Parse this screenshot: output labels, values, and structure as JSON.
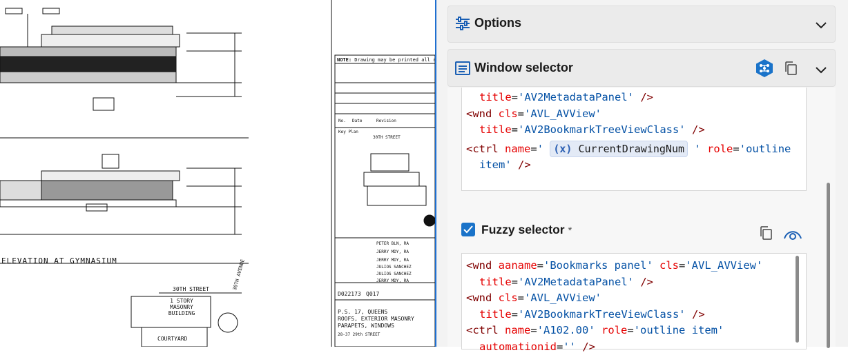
{
  "drawing": {
    "notice_label": "NOTE:",
    "notice_text": "Drawing may be printed all reduced",
    "date_label": "No.",
    "date_col": "Date",
    "revision_col": "Revision",
    "key_plan": "Key Plan",
    "street_top": "30TH STREET",
    "street_bottom": "30TH STREET",
    "avenue": "30TH AVENUE",
    "elevation_title": "ELEVATION AT GYMNASIUM",
    "story_building": "1 STORY MASONRY BUILDING",
    "courtyard": "COURTYARD",
    "project_number": "D022173",
    "project_label": "Q017",
    "project_title": "P.S. 17, QUEENS",
    "project_subtitle": "ROOFS, EXTERIOR MASONRY",
    "project_subtitle2": "PARAPETS, WINDOWS",
    "address": "28-37 29th STREET",
    "names": [
      "PETER BLN, RA",
      "JERRY MDY, RA",
      "JERRY MDY, RA",
      "JULIOS SANCHEZ",
      "JULIOS SANCHEZ",
      "JERRY MDY, RA"
    ]
  },
  "options": {
    "title": "Options",
    "icon": "sliders-icon",
    "chevron": "chevron-down-icon"
  },
  "window_selector": {
    "title": "Window selector",
    "icon": "window-icon",
    "action_icon": "tree-picker-icon",
    "copy_icon": "copy-icon",
    "chevron": "chevron-down-icon",
    "colors": {
      "action": "#1a73c9"
    },
    "code": {
      "line1": {
        "attr": "title",
        "eq": "=",
        "val": "'AV2MetadataPanel'",
        "end": " />"
      },
      "line2": {
        "tag": "<wnd",
        "attr": "cls",
        "eq": "=",
        "val": "'AVL_AVView'"
      },
      "line3": {
        "attr": "title",
        "eq": "=",
        "val": "'AV2BookmarkTreeViewClass'",
        "end": " />"
      },
      "line4": {
        "tag": "<ctrl",
        "attr": "name",
        "eq": "=",
        "q1": "'",
        "chip_icon": "(x)",
        "chip": "CurrentDrawingNum",
        "q2": "'",
        "attr2": "role",
        "eq2": "=",
        "val2": "'outline"
      },
      "line5": {
        "val": "item'",
        "end": " />"
      }
    }
  },
  "fuzzy": {
    "label": "Fuzzy selector",
    "required": "*",
    "checked": true,
    "copy_icon": "copy-icon",
    "eye_icon": "highlight-eye-icon",
    "code": {
      "line1": {
        "tag": "<wnd",
        "attr": "aaname",
        "eq": "=",
        "val": "'Bookmarks panel'",
        "attr2": "cls",
        "eq2": "=",
        "val2": "'AVL_AVView'"
      },
      "line2": {
        "attr": "title",
        "eq": "=",
        "val": "'AV2MetadataPanel'",
        "end": " />"
      },
      "line3": {
        "tag": "<wnd",
        "attr": "cls",
        "eq": "=",
        "val": "'AVL_AVView'"
      },
      "line4": {
        "attr": "title",
        "eq": "=",
        "val": "'AV2BookmarkTreeViewClass'",
        "end": " />"
      },
      "line5": {
        "tag": "<ctrl",
        "attr": "name",
        "eq": "=",
        "val": "'A102.00'",
        "attr2": "role",
        "eq2": "=",
        "val2": "'outline item'"
      },
      "line6": {
        "attr": "automationid",
        "eq": "=",
        "val": "''",
        "end": " />"
      }
    }
  }
}
